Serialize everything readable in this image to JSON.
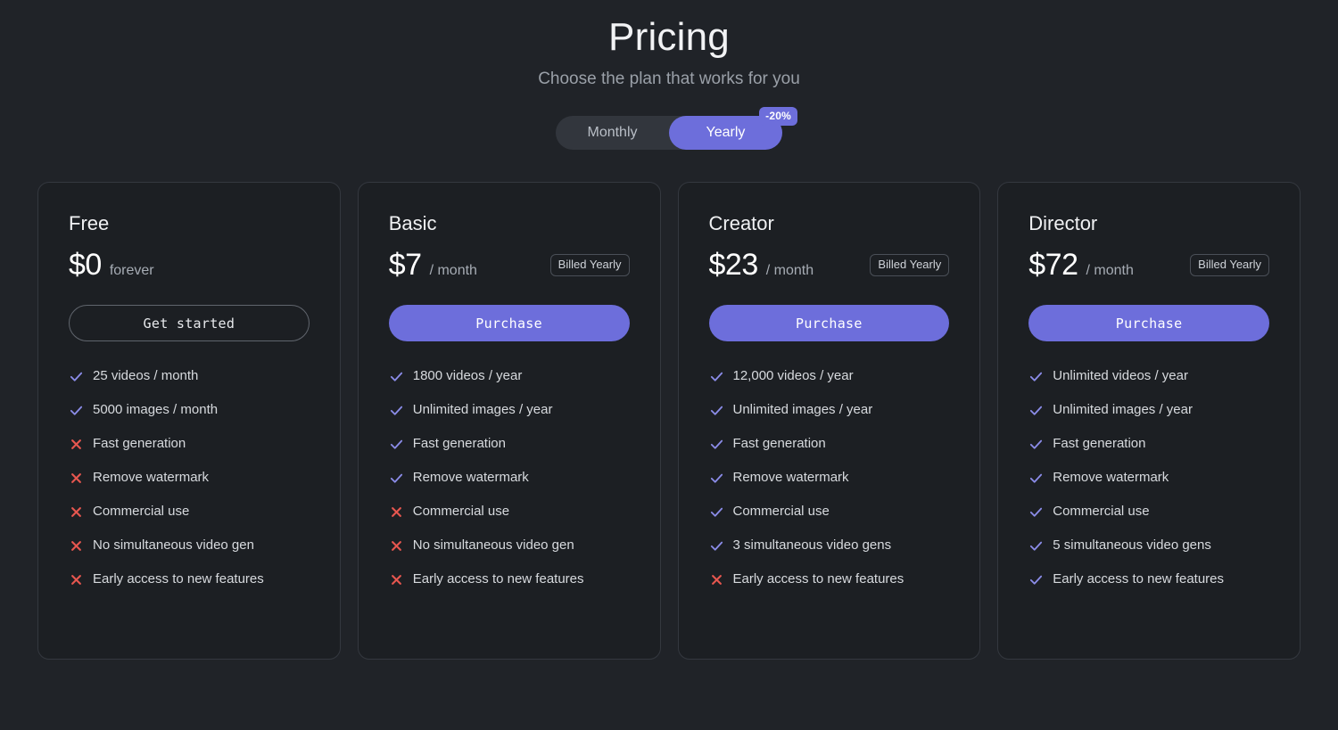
{
  "header": {
    "title": "Pricing",
    "subtitle": "Choose the plan that works for you"
  },
  "billing_toggle": {
    "monthly_label": "Monthly",
    "yearly_label": "Yearly",
    "selected": "Yearly",
    "discount_badge": "-20%"
  },
  "colors": {
    "page_background": "#202328",
    "card_background": "#1c1f23",
    "card_border": "#34383f",
    "accent_purple": "#6d6edb",
    "check_icon": "#8b8ce8",
    "cross_icon": "#e5564f",
    "title_text": "#f2f3f5",
    "muted_text": "#9aa0a8"
  },
  "plans": [
    {
      "name": "Free",
      "price": "$0",
      "period": "forever",
      "billed_badge": "",
      "cta_label": "Get started",
      "cta_style": "outline",
      "features": [
        {
          "label": "25 videos / month",
          "included": true
        },
        {
          "label": "5000 images / month",
          "included": true
        },
        {
          "label": "Fast generation",
          "included": false
        },
        {
          "label": "Remove watermark",
          "included": false
        },
        {
          "label": "Commercial use",
          "included": false
        },
        {
          "label": "No simultaneous video gen",
          "included": false
        },
        {
          "label": "Early access to new features",
          "included": false
        }
      ]
    },
    {
      "name": "Basic",
      "price": "$7",
      "period": "/ month",
      "billed_badge": "Billed Yearly",
      "cta_label": "Purchase",
      "cta_style": "primary",
      "features": [
        {
          "label": "1800 videos / year",
          "included": true
        },
        {
          "label": "Unlimited images / year",
          "included": true
        },
        {
          "label": "Fast generation",
          "included": true
        },
        {
          "label": "Remove watermark",
          "included": true
        },
        {
          "label": "Commercial use",
          "included": false
        },
        {
          "label": "No simultaneous video gen",
          "included": false
        },
        {
          "label": "Early access to new features",
          "included": false
        }
      ]
    },
    {
      "name": "Creator",
      "price": "$23",
      "period": "/ month",
      "billed_badge": "Billed Yearly",
      "cta_label": "Purchase",
      "cta_style": "primary",
      "features": [
        {
          "label": "12,000 videos / year",
          "included": true
        },
        {
          "label": "Unlimited images / year",
          "included": true
        },
        {
          "label": "Fast generation",
          "included": true
        },
        {
          "label": "Remove watermark",
          "included": true
        },
        {
          "label": "Commercial use",
          "included": true
        },
        {
          "label": "3 simultaneous video gens",
          "included": true
        },
        {
          "label": "Early access to new features",
          "included": false
        }
      ]
    },
    {
      "name": "Director",
      "price": "$72",
      "period": "/ month",
      "billed_badge": "Billed Yearly",
      "cta_label": "Purchase",
      "cta_style": "primary",
      "features": [
        {
          "label": "Unlimited videos / year",
          "included": true
        },
        {
          "label": "Unlimited images / year",
          "included": true
        },
        {
          "label": "Fast generation",
          "included": true
        },
        {
          "label": "Remove watermark",
          "included": true
        },
        {
          "label": "Commercial use",
          "included": true
        },
        {
          "label": "5 simultaneous video gens",
          "included": true
        },
        {
          "label": "Early access to new features",
          "included": true
        }
      ]
    }
  ],
  "icons": {
    "check": "check-icon",
    "cross": "cross-icon"
  }
}
